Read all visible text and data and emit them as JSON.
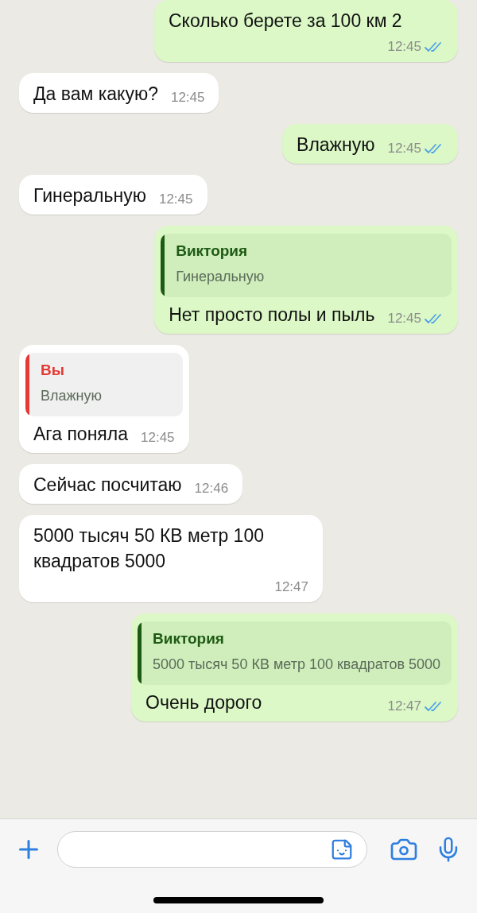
{
  "messages": [
    {
      "kind": "out",
      "text": "Сколько берете за 100 км 2",
      "time": "12:45",
      "read": true
    },
    {
      "kind": "in",
      "text": "Да вам какую?",
      "time": "12:45"
    },
    {
      "kind": "out",
      "text": "Влажную",
      "time": "12:45",
      "read": true
    },
    {
      "kind": "in",
      "text": "Гинеральную",
      "time": "12:45"
    },
    {
      "kind": "out",
      "quote": {
        "author": "Виктория",
        "text": "Гинеральную",
        "color": "#1e5a14"
      },
      "text": "Нет просто полы и пыль",
      "time": "12:45",
      "read": true
    },
    {
      "kind": "in",
      "quote": {
        "author": "Вы",
        "text": "Влажную",
        "color": "#e53935"
      },
      "text": "Ага поняла",
      "time": "12:45"
    },
    {
      "kind": "in",
      "text": "Сейчас посчитаю",
      "time": "12:46"
    },
    {
      "kind": "in",
      "text": "5000 тысяч 50 КВ метр 100 квадратов 5000",
      "time": "12:47"
    },
    {
      "kind": "out",
      "quote": {
        "author": "Виктория",
        "text": "5000 тысяч 50 КВ метр 100 квадратов 5000",
        "color": "#1e5a14"
      },
      "text": "Очень дорого",
      "time": "12:47",
      "read": true
    }
  ]
}
